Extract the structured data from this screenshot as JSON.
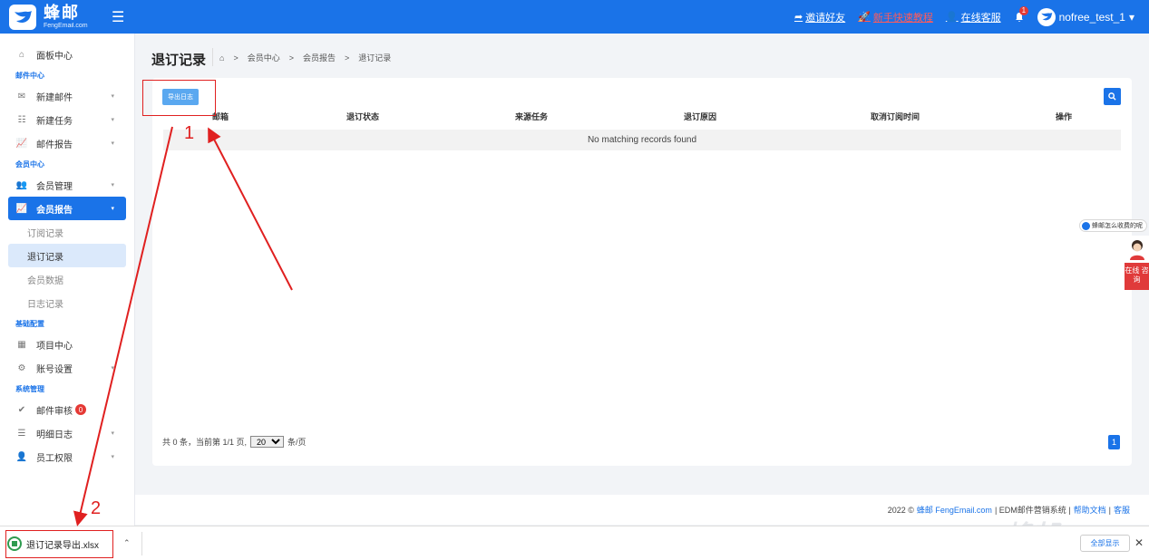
{
  "topbar": {
    "logo_cn": "蜂邮",
    "logo_en": "FengEmail.com",
    "invite": "邀请好友",
    "tutorial": "新手快速教程",
    "support": "在线客服",
    "bell_count": "1",
    "username": "nofree_test_1"
  },
  "sidebar": {
    "dashboard": "面板中心",
    "group_mail": "邮件中心",
    "new_mail": "新建邮件",
    "new_task": "新建任务",
    "mail_report": "邮件报告",
    "group_member": "会员中心",
    "member_manage": "会员管理",
    "member_report": "会员报告",
    "sub_subscribe": "订阅记录",
    "sub_unsubscribe": "退订记录",
    "sub_member_data": "会员数据",
    "sub_log": "日志记录",
    "group_base": "基础配置",
    "project_center": "项目中心",
    "account_settings": "账号设置",
    "group_system": "系统管理",
    "mail_review": "邮件审核",
    "mail_review_badge": "0",
    "detail_log": "明细日志",
    "staff_perm": "员工权限"
  },
  "main": {
    "title": "退订记录",
    "breadcrumb": [
      "会员中心",
      "会员报告",
      "退订记录"
    ],
    "export_label": "导出日志",
    "columns": [
      "邮箱",
      "退订状态",
      "来源任务",
      "退订原因",
      "取消订阅时间",
      "操作"
    ],
    "no_records": "No matching records found",
    "pager_prefix": "共 0 条，当前第 1/1 页,",
    "page_size": "20",
    "pager_suffix": "条/页",
    "current_page": "1"
  },
  "footer": {
    "year": "2022 ©",
    "brand": "蜂邮 FengEmail.com",
    "system": "| EDM邮件营销系统 |",
    "help": "帮助文档",
    "sep": "|",
    "service": "客服"
  },
  "widgets": {
    "chat_text": "蜂邮怎么收费的呢",
    "consult": "在线 咨询"
  },
  "download_bar": {
    "file_name": "退订记录导出.xlsx",
    "show_all": "全部显示"
  },
  "watermark": "蜂邮EDM",
  "annotations": {
    "label_1": "1",
    "label_2": "2"
  }
}
